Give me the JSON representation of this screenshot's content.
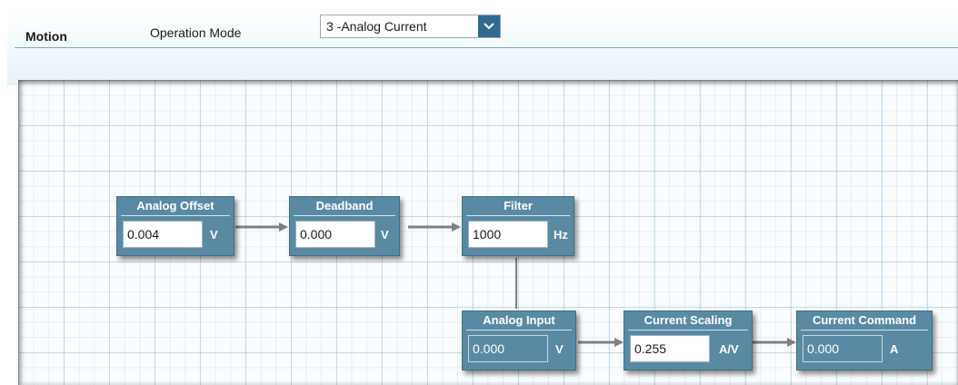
{
  "header": {
    "title": "Motion",
    "mode_label": "Operation Mode",
    "mode_value": "3 -Analog Current"
  },
  "blocks": {
    "analog_offset": {
      "title": "Analog Offset",
      "value": "0.004",
      "unit": "V"
    },
    "deadband": {
      "title": "Deadband",
      "value": "0.000",
      "unit": "V"
    },
    "filter": {
      "title": "Filter",
      "value": "1000",
      "unit": "Hz"
    },
    "analog_input": {
      "title": "Analog Input",
      "value": "0.000",
      "unit": "V"
    },
    "current_scaling": {
      "title": "Current Scaling",
      "value": "0.255",
      "unit": "A/V"
    },
    "current_command": {
      "title": "Current Command",
      "value": "0.000",
      "unit": "A"
    }
  },
  "colors": {
    "block_fill": "#5a8aa3",
    "dropdown_accent": "#2f6b8e",
    "wire": "#808080"
  },
  "icons": {
    "dropdown": "chevron-down-icon",
    "connector": "arrow-right-icon"
  }
}
